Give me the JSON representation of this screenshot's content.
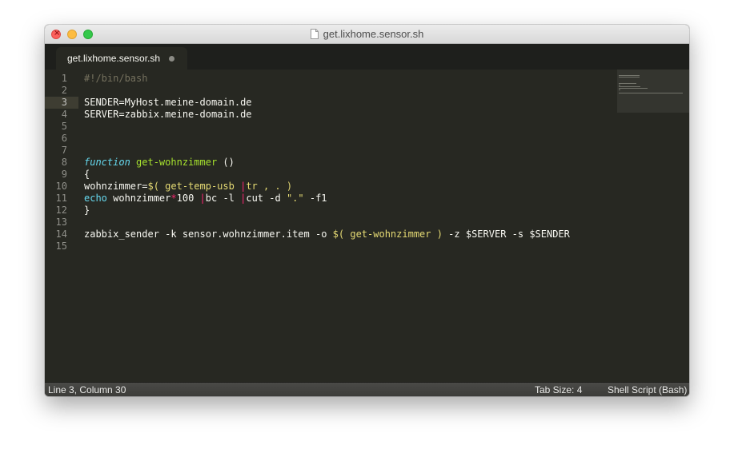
{
  "window": {
    "title": "get.lixhome.sensor.sh"
  },
  "tab": {
    "label": "get.lixhome.sensor.sh",
    "state": "unsaved"
  },
  "editor": {
    "current_line": 3,
    "lines": [
      {
        "num": "1",
        "tokens": [
          {
            "t": "#!/bin/bash",
            "c": "comment"
          }
        ]
      },
      {
        "num": "2",
        "tokens": []
      },
      {
        "num": "3",
        "tokens": [
          {
            "t": "SENDER=MyHost.meine-domain.de",
            "c": "plain"
          }
        ]
      },
      {
        "num": "4",
        "tokens": [
          {
            "t": "SERVER=zabbix.meine-domain.de",
            "c": "plain"
          }
        ]
      },
      {
        "num": "5",
        "tokens": []
      },
      {
        "num": "6",
        "tokens": []
      },
      {
        "num": "7",
        "tokens": []
      },
      {
        "num": "8",
        "tokens": [
          {
            "t": "function",
            "c": "keyword"
          },
          {
            "t": " ",
            "c": "plain"
          },
          {
            "t": "get-wohnzimmer",
            "c": "func"
          },
          {
            "t": " ()",
            "c": "plain"
          }
        ]
      },
      {
        "num": "9",
        "tokens": [
          {
            "t": "{",
            "c": "plain"
          }
        ]
      },
      {
        "num": "10",
        "tokens": [
          {
            "t": "wohnzimmer=",
            "c": "plain"
          },
          {
            "t": "$( get-temp-usb ",
            "c": "yellow"
          },
          {
            "t": "|",
            "c": "op"
          },
          {
            "t": "tr , . )",
            "c": "yellow"
          }
        ]
      },
      {
        "num": "11",
        "tokens": [
          {
            "t": "echo",
            "c": "builtin"
          },
          {
            "t": " wohnzimmer",
            "c": "plain"
          },
          {
            "t": "*",
            "c": "op"
          },
          {
            "t": "100 ",
            "c": "plain"
          },
          {
            "t": "|",
            "c": "op"
          },
          {
            "t": "bc -l ",
            "c": "plain"
          },
          {
            "t": "|",
            "c": "op"
          },
          {
            "t": "cut -d ",
            "c": "plain"
          },
          {
            "t": "\".\"",
            "c": "yellow"
          },
          {
            "t": " -f1",
            "c": "plain"
          }
        ]
      },
      {
        "num": "12",
        "tokens": [
          {
            "t": "}",
            "c": "plain"
          }
        ]
      },
      {
        "num": "13",
        "tokens": []
      },
      {
        "num": "14",
        "tokens": [
          {
            "t": "zabbix_sender -k sensor.wohnzimmer.item -o ",
            "c": "plain"
          },
          {
            "t": "$( get-wohnzimmer )",
            "c": "yellow"
          },
          {
            "t": " -z $SERVER -s $SENDER",
            "c": "plain"
          }
        ]
      },
      {
        "num": "15",
        "tokens": []
      }
    ]
  },
  "status": {
    "position": "Line 3, Column 30",
    "tab_size": "Tab Size: 4",
    "syntax": "Shell Script (Bash)"
  },
  "colors": {
    "background": "#272822",
    "comment": "#75715e",
    "keyword": "#66d9ef",
    "function": "#a6e22e",
    "string": "#e6db74",
    "operator": "#f92672"
  },
  "icons": {
    "title_icon": "document-icon",
    "tab_state_icon": "unsaved-dot-icon"
  }
}
